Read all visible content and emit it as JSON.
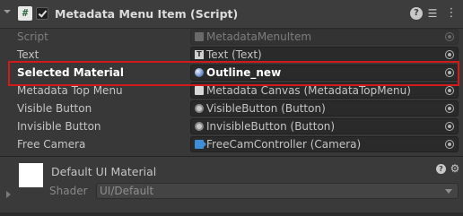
{
  "component": {
    "title": "Metadata Menu Item (Script)",
    "enabled": true,
    "script_icon_glyph": "#"
  },
  "fields": [
    {
      "label": "Script",
      "value": "MetadataMenuItem",
      "icon": "script-icon",
      "disabled": true
    },
    {
      "label": "Text",
      "value": "Text (Text)",
      "icon": "text-icon"
    },
    {
      "label": "Selected Material",
      "value": "Outline_new",
      "icon": "material-icon",
      "selected": true
    },
    {
      "label": "Metadata Top Menu",
      "value": "Metadata Canvas (MetadataTopMenu)",
      "icon": "canvas-icon"
    },
    {
      "label": "Visible Button",
      "value": "VisibleButton (Button)",
      "icon": "button-icon"
    },
    {
      "label": "Invisible Button",
      "value": "InvisibleButton (Button)",
      "icon": "button-icon"
    },
    {
      "label": "Free Camera",
      "value": "FreeCamController (Camera)",
      "icon": "camera-icon"
    }
  ],
  "material": {
    "name": "Default UI Material",
    "shader_label": "Shader",
    "shader_value": "UI/Default"
  },
  "colors": {
    "highlight": "#d11a1a",
    "background": "#383838"
  }
}
